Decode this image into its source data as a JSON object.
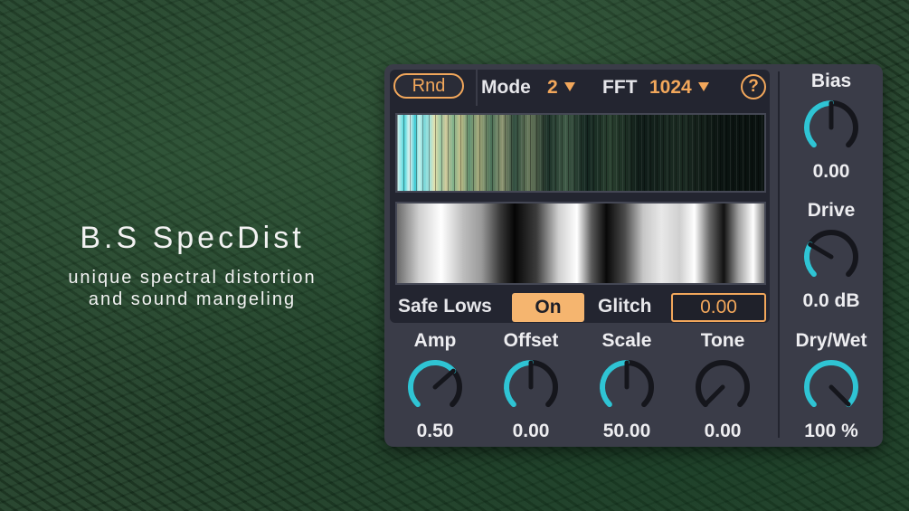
{
  "promo": {
    "title": "B.S SpecDist",
    "subtitle_line1": "unique spectral distortion",
    "subtitle_line2": "and sound mangeling"
  },
  "colors": {
    "accent_orange": "#f2a75b",
    "knob_cyan": "#2fc4d4",
    "knob_track": "#15161c",
    "panel_bg": "#3a3c48",
    "inner_bg": "#232530"
  },
  "topbar": {
    "rnd_label": "Rnd",
    "mode_label": "Mode",
    "mode_value": "2",
    "fft_label": "FFT",
    "fft_value": "1024",
    "dropdown_icon": "triangle-down-icon",
    "help_label": "?"
  },
  "lowbar": {
    "safe_lows_label": "Safe Lows",
    "safe_lows_value": "On",
    "glitch_label": "Glitch",
    "glitch_value": "0.00"
  },
  "knobs": {
    "amp": {
      "label": "Amp",
      "value": "0.50",
      "fraction": 0.68
    },
    "offset": {
      "label": "Offset",
      "value": "0.00",
      "fraction": 0.5
    },
    "scale": {
      "label": "Scale",
      "value": "50.00",
      "fraction": 0.5
    },
    "tone": {
      "label": "Tone",
      "value": "0.00",
      "fraction": 0.0
    },
    "bias": {
      "label": "Bias",
      "value": "0.00",
      "fraction": 0.5
    },
    "drive": {
      "label": "Drive",
      "value": "0.0 dB",
      "fraction": 0.28
    },
    "drywet": {
      "label": "Dry/Wet",
      "value": "100 %",
      "fraction": 1.0
    }
  }
}
